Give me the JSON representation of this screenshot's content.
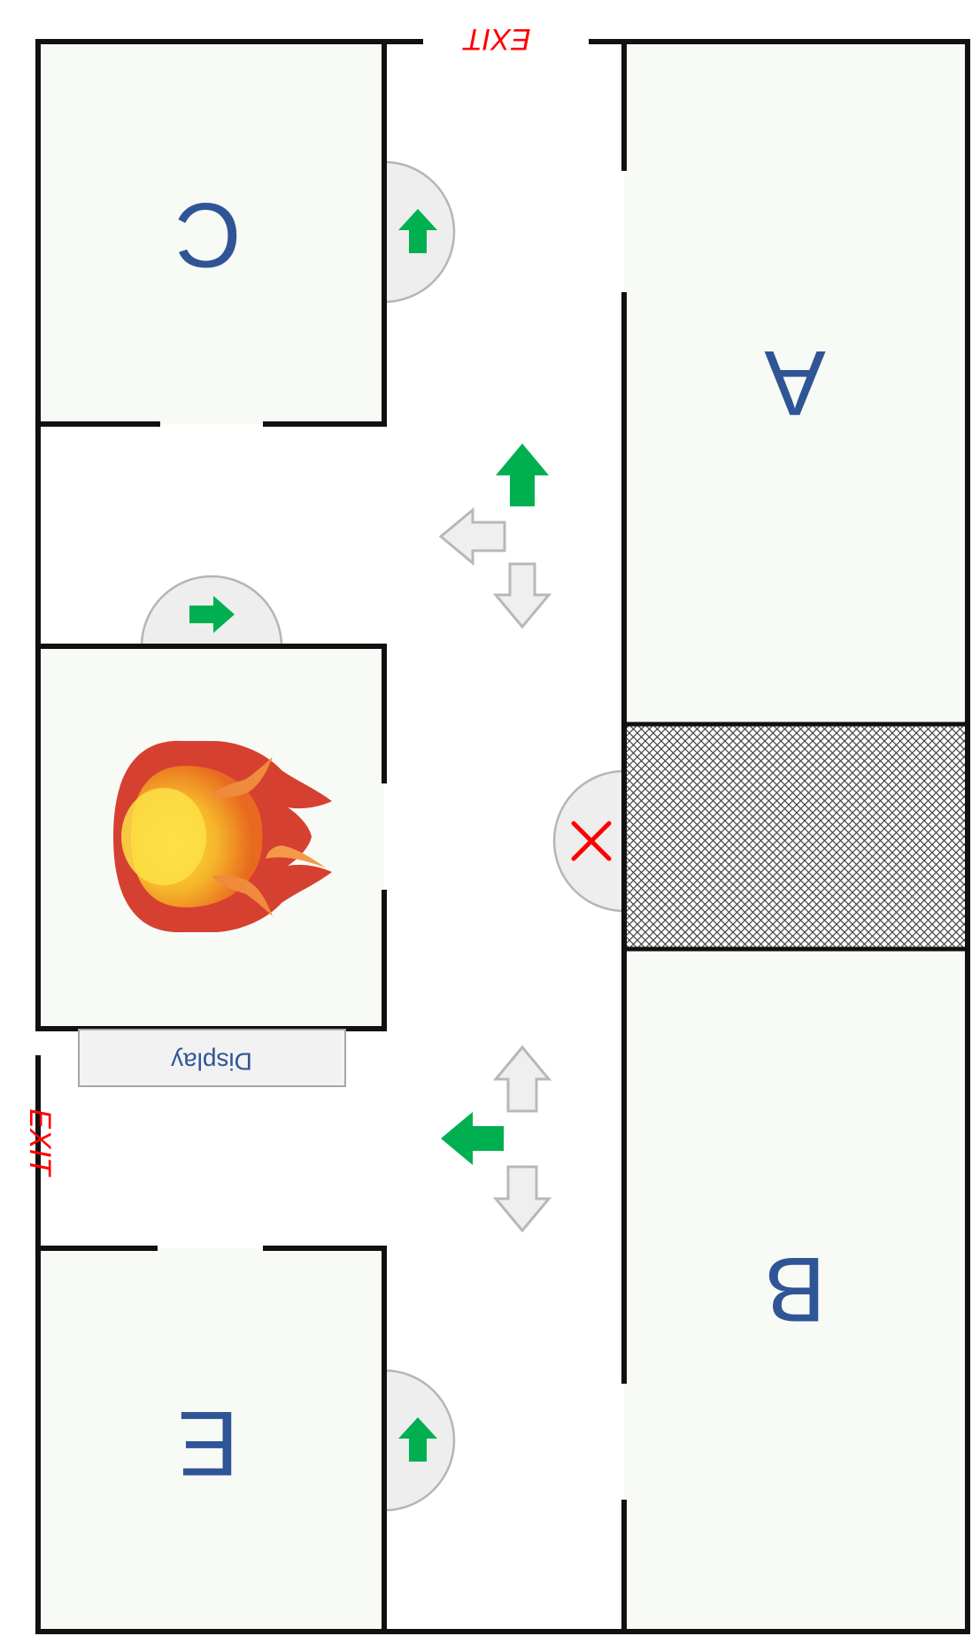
{
  "rooms": {
    "a": "A",
    "b": "B",
    "c": "C",
    "e": "E"
  },
  "exits": {
    "top": "EXIT",
    "left": "EXIT"
  },
  "display_label": "Display",
  "blocked_marker": "✕",
  "colors": {
    "room_fill": "#f8faf5",
    "wall": "#111111",
    "safe_arrow": "#00b050",
    "inactive_arrow": "#efefef",
    "exit_text": "#ff0000",
    "room_label": "#2f5597",
    "blocked_marker": "#ff0000"
  },
  "icons": {
    "fire": "fire-icon",
    "blocked": "blocked-x-icon",
    "safe_route": "green-arrow-icon",
    "inactive_route": "grey-arrow-icon",
    "obstruction": "hatched-obstruction"
  }
}
